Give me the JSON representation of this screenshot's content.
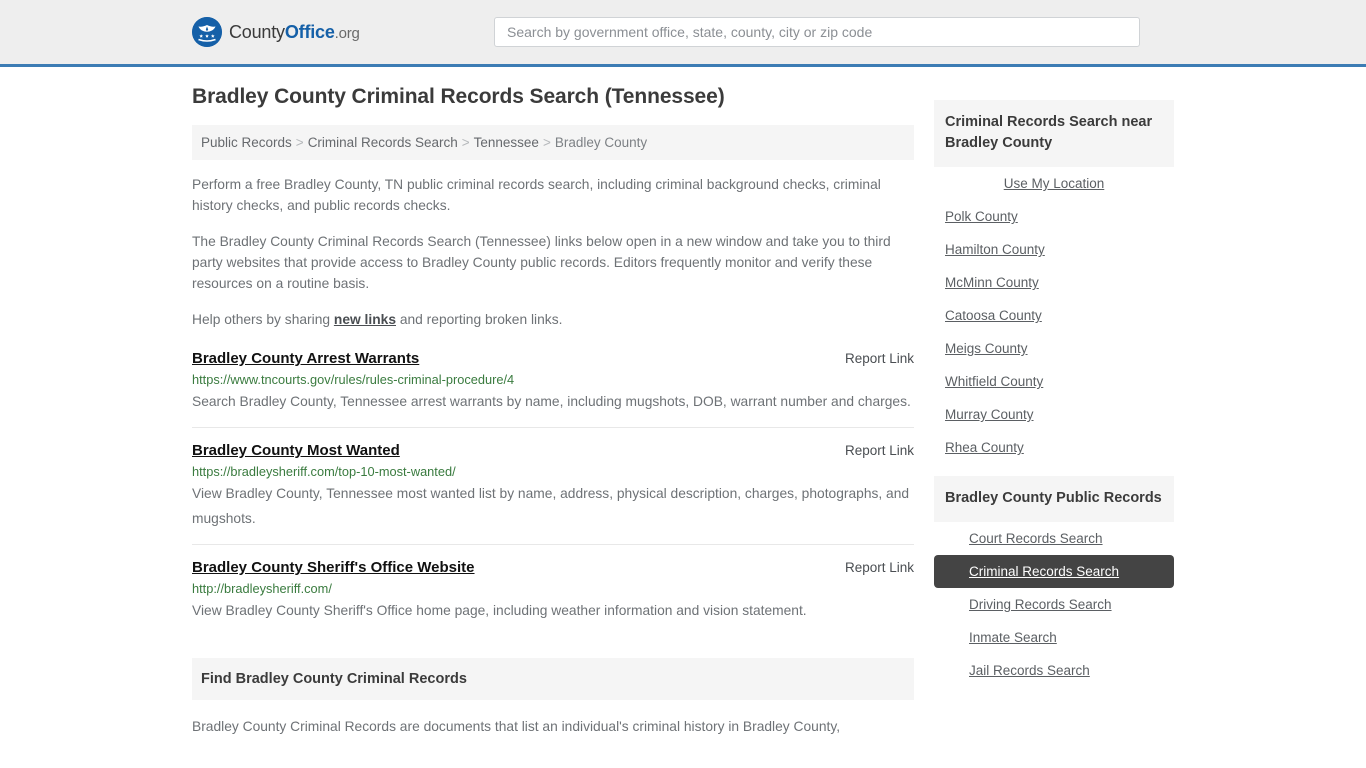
{
  "header": {
    "logo": {
      "icon": "eagle-seal-icon",
      "part1": "County",
      "part2": "Office",
      "part3": ".org"
    },
    "search": {
      "placeholder": "Search by government office, state, county, city or zip code",
      "value": ""
    },
    "accent_color": "#3c7cb4"
  },
  "main": {
    "title": "Bradley County Criminal Records Search (Tennessee)",
    "breadcrumb": {
      "separator": ">",
      "items": [
        {
          "label": "Public Records",
          "current": false
        },
        {
          "label": "Criminal Records Search",
          "current": false
        },
        {
          "label": "Tennessee",
          "current": false
        },
        {
          "label": "Bradley County",
          "current": true
        }
      ]
    },
    "intro": [
      "Perform a free Bradley County, TN public criminal records search, including criminal background checks, criminal history checks, and public records checks.",
      "The Bradley County Criminal Records Search (Tennessee) links below open in a new window and take you to third party websites that provide access to Bradley County public records. Editors frequently monitor and verify these resources on a routine basis."
    ],
    "help_text_before": "Help others by sharing ",
    "help_link": "new links",
    "help_text_after": " and reporting broken links.",
    "report_link_label": "Report Link",
    "links": [
      {
        "title": "Bradley County Arrest Warrants",
        "url": "https://www.tncourts.gov/rules/rules-criminal-procedure/4",
        "description": "Search Bradley County, Tennessee arrest warrants by name, including mugshots, DOB, warrant number and charges."
      },
      {
        "title": "Bradley County Most Wanted",
        "url": "https://bradleysheriff.com/top-10-most-wanted/",
        "description": "View Bradley County, Tennessee most wanted list by name, address, physical description, charges, photographs, and mugshots."
      },
      {
        "title": "Bradley County Sheriff's Office Website",
        "url": "http://bradleysheriff.com/",
        "description": "View Bradley County Sheriff's Office home page, including weather information and vision statement."
      }
    ],
    "find_section": {
      "heading": "Find Bradley County Criminal Records",
      "paragraph": "Bradley County Criminal Records are documents that list an individual's criminal history in Bradley County,"
    }
  },
  "sidebar": {
    "boxes": [
      {
        "heading": "Criminal Records Search near Bradley County",
        "items": [
          {
            "label": "Use My Location",
            "style": "centered",
            "active": false
          },
          {
            "label": "Polk County",
            "style": "plain",
            "active": false
          },
          {
            "label": "Hamilton County",
            "style": "plain",
            "active": false
          },
          {
            "label": "McMinn County",
            "style": "plain",
            "active": false
          },
          {
            "label": "Catoosa County",
            "style": "plain",
            "active": false
          },
          {
            "label": "Meigs County",
            "style": "plain",
            "active": false
          },
          {
            "label": "Whitfield County",
            "style": "plain",
            "active": false
          },
          {
            "label": "Murray County",
            "style": "plain",
            "active": false
          },
          {
            "label": "Rhea County",
            "style": "plain",
            "active": false
          }
        ]
      },
      {
        "heading": "Bradley County Public Records",
        "items": [
          {
            "label": "Court Records Search",
            "style": "indented",
            "active": false
          },
          {
            "label": "Criminal Records Search",
            "style": "indented",
            "active": true
          },
          {
            "label": "Driving Records Search",
            "style": "indented",
            "active": false
          },
          {
            "label": "Inmate Search",
            "style": "indented",
            "active": false
          },
          {
            "label": "Jail Records Search",
            "style": "indented",
            "active": false
          }
        ]
      }
    ],
    "active_color": "#444444"
  }
}
